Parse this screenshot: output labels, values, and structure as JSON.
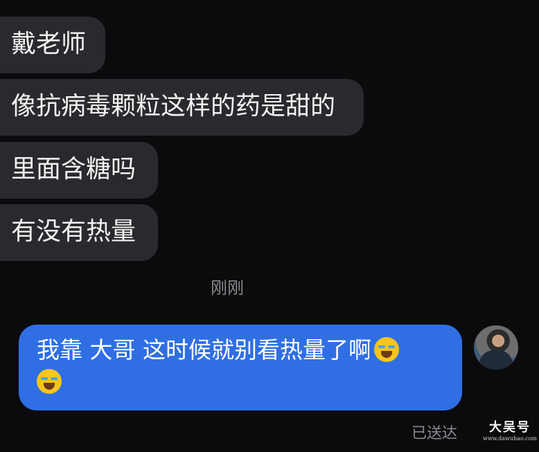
{
  "incoming_messages": [
    {
      "text": "戴老师"
    },
    {
      "text": "像抗病毒颗粒这样的药是甜的"
    },
    {
      "text": "里面含糖吗"
    },
    {
      "text": "有没有热量"
    }
  ],
  "timestamp": "刚刚",
  "outgoing_message": {
    "text_part1": "我靠 大哥 这时候就别看热量了啊",
    "emoji_name": "crying-laughing-emoji"
  },
  "status": "已送达",
  "watermark": {
    "main": "大吴号",
    "sub": "www.dawuhao.com"
  },
  "colors": {
    "background": "#0b0b0d",
    "incoming_bubble": "#2a2a2e",
    "outgoing_bubble": "#2f6fe3",
    "muted_text": "#8a8a8e"
  }
}
